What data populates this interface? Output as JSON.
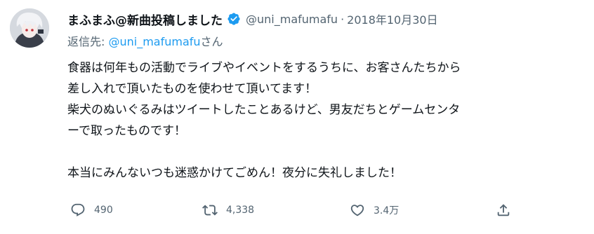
{
  "user": {
    "display_name": "まふまふ@新曲投稿しました",
    "handle": "@uni_mafumafu",
    "separator": "·",
    "timestamp": "2018年10月30日"
  },
  "reply_to": {
    "prefix": "返信先: ",
    "mention": "@uni_mafumafu",
    "suffix": "さん"
  },
  "tweet_text": "食器は何年もの活動でライブやイベントをするうちに、お客さんたちから\n差し入れで頂いたものを使わせて頂いてます！\n柴犬のぬいぐるみはツイートしたことあるけど、男友だちとゲームセンタ\nーで取ったものです！\n\n本当にみんないつも迷惑かけてごめん！夜分に失礼しました！",
  "actions": {
    "reply_count": "490",
    "retweet_count": "4,338",
    "like_count": "3.4万"
  },
  "colors": {
    "verified_badge": "#1d9bf0",
    "secondary_text": "#536471",
    "link": "#1d9bf0",
    "primary_text": "#0f1419"
  }
}
